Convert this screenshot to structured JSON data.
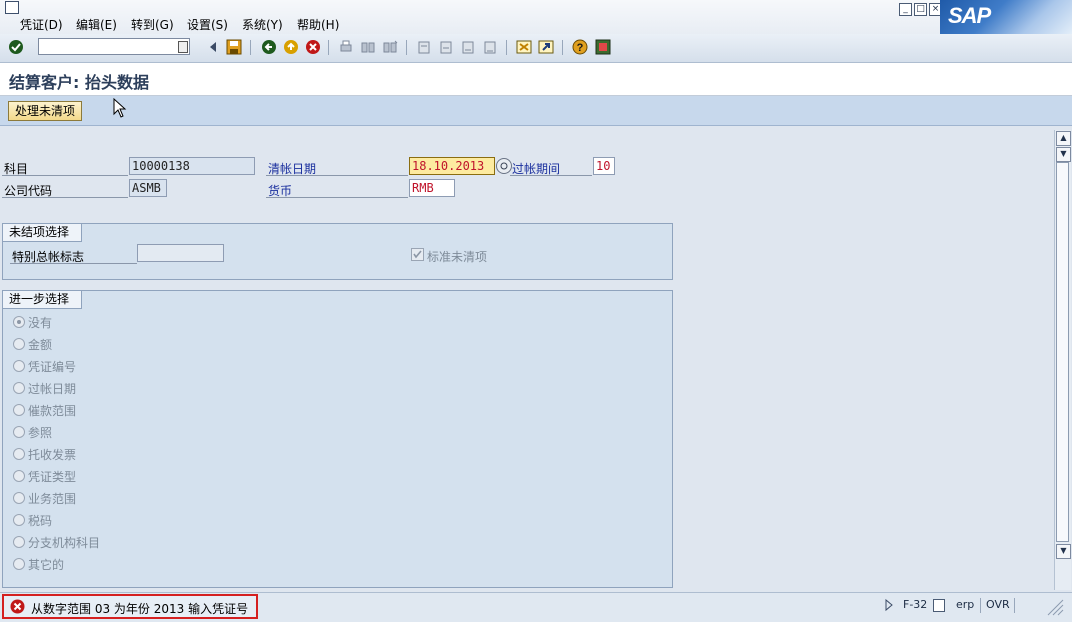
{
  "menu": {
    "items": [
      "凭证(D)",
      "编辑(E)",
      "转到(G)",
      "设置(S)",
      "系统(Y)",
      "帮助(H)"
    ]
  },
  "logo": {
    "text": "SAP"
  },
  "title": "结算客户: 抬头数据",
  "app_toolbar": {
    "process_button": "处理未清项"
  },
  "header_fields": {
    "account_label": "科目",
    "account_value": "10000138",
    "company_label": "公司代码",
    "company_value": "ASMB",
    "clearing_date_label": "清帐日期",
    "clearing_date_value": "18.10.2013",
    "period_label": "过帐期间",
    "period_value": "10",
    "currency_label": "货币",
    "currency_value": "RMB"
  },
  "open_items_group": {
    "title": "未结项选择",
    "special_gl_label": "特别总帐标志",
    "special_gl_value": "",
    "standard_items_label": "标准未清项"
  },
  "further_selection": {
    "title": "进一步选择",
    "options": [
      "没有",
      "金额",
      "凭证编号",
      "过帐日期",
      "催款范围",
      "参照",
      "托收发票",
      "凭证类型",
      "业务范围",
      "税码",
      "分支机构科目",
      "其它的"
    ],
    "selected_index": 0
  },
  "status": {
    "message": "从数字范围 03 为年份 2013 输入凭证号",
    "transaction": "F-32",
    "system": "erp",
    "mode": "OVR"
  },
  "colors": {
    "accent_blue": "#1a2f9e",
    "required_red": "#c0142b",
    "error_red": "#d52020"
  }
}
